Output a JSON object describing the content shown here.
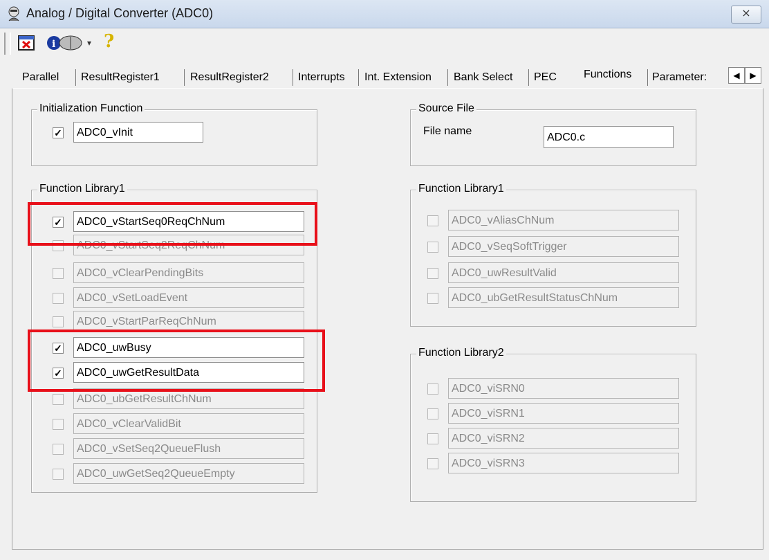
{
  "window": {
    "title": "Analog / Digital Converter  (ADC0)",
    "close_glyph": "⨯"
  },
  "toolbar": {
    "help_glyph": "?",
    "dropdown_glyph": "▾"
  },
  "tabs": [
    {
      "label": "Parallel"
    },
    {
      "label": "ResultRegister1"
    },
    {
      "label": "ResultRegister2"
    },
    {
      "label": "Interrupts"
    },
    {
      "label": "Int. Extension"
    },
    {
      "label": "Bank Select"
    },
    {
      "label": "PEC"
    },
    {
      "label": "Functions"
    },
    {
      "label": "Parameter:"
    }
  ],
  "active_tab": "Functions",
  "scroll": {
    "left": "◀",
    "right": "▶"
  },
  "init": {
    "title": "Initialization Function",
    "items": [
      {
        "label": "ADC0_vInit",
        "checked": true,
        "enabled": true
      }
    ]
  },
  "source": {
    "title": "Source File",
    "file_label": "File name",
    "file_value": "ADC0.c"
  },
  "lib1_left": {
    "title": "Function Library1",
    "items": [
      {
        "label": "ADC0_vStartSeq0ReqChNum",
        "checked": true,
        "enabled": true
      },
      {
        "label": "ADC0_vStartSeq2ReqChNum",
        "checked": false,
        "enabled": false
      },
      {
        "label": "ADC0_vClearPendingBits",
        "checked": false,
        "enabled": false
      },
      {
        "label": "ADC0_vSetLoadEvent",
        "checked": false,
        "enabled": false
      },
      {
        "label": "ADC0_vStartParReqChNum",
        "checked": false,
        "enabled": false
      },
      {
        "label": "ADC0_uwBusy",
        "checked": true,
        "enabled": true
      },
      {
        "label": "ADC0_uwGetResultData",
        "checked": true,
        "enabled": true
      },
      {
        "label": "ADC0_ubGetResultChNum",
        "checked": false,
        "enabled": false
      },
      {
        "label": "ADC0_vClearValidBit",
        "checked": false,
        "enabled": false
      },
      {
        "label": "ADC0_vSetSeq2QueueFlush",
        "checked": false,
        "enabled": false
      },
      {
        "label": "ADC0_uwGetSeq2QueueEmpty",
        "checked": false,
        "enabled": false
      }
    ]
  },
  "lib1_right": {
    "title": "Function Library1",
    "items": [
      {
        "label": "ADC0_vAliasChNum",
        "checked": false,
        "enabled": false
      },
      {
        "label": "ADC0_vSeqSoftTrigger",
        "checked": false,
        "enabled": false
      },
      {
        "label": "ADC0_uwResultValid",
        "checked": false,
        "enabled": false
      },
      {
        "label": "ADC0_ubGetResultStatusChNum",
        "checked": false,
        "enabled": false
      }
    ]
  },
  "lib2_right": {
    "title": "Function Library2",
    "items": [
      {
        "label": "ADC0_viSRN0",
        "checked": false,
        "enabled": false
      },
      {
        "label": "ADC0_viSRN1",
        "checked": false,
        "enabled": false
      },
      {
        "label": "ADC0_viSRN2",
        "checked": false,
        "enabled": false
      },
      {
        "label": "ADC0_viSRN3",
        "checked": false,
        "enabled": false
      }
    ]
  },
  "colors": {
    "highlight": "#e8101a",
    "disabled_text": "#8a8a8a"
  },
  "icons": [
    "wizard-icon",
    "close-icon",
    "exit-icon",
    "info-book-icon",
    "help-icon"
  ]
}
